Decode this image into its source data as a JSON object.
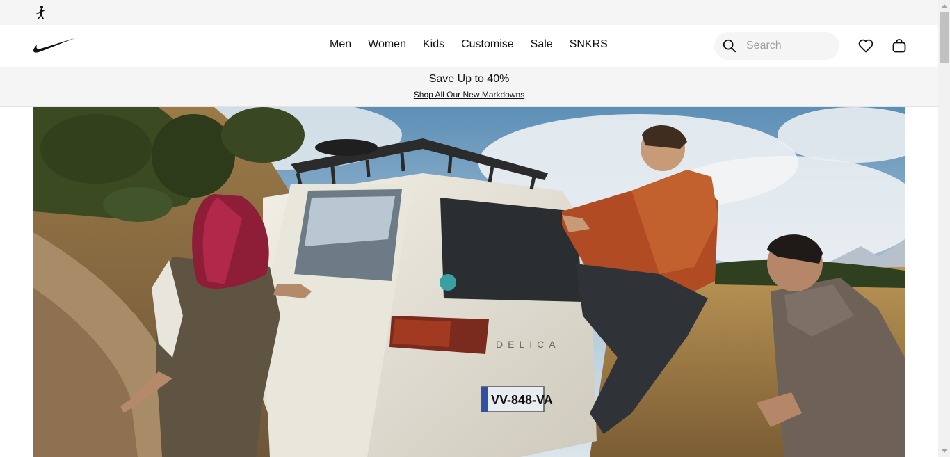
{
  "top_bar": {
    "logo_icon": "jordan-jumpman-icon"
  },
  "header": {
    "logo_icon": "nike-swoosh-icon",
    "nav": [
      {
        "label": "Men"
      },
      {
        "label": "Women"
      },
      {
        "label": "Kids"
      },
      {
        "label": "Customise"
      },
      {
        "label": "Sale"
      },
      {
        "label": "SNKRS"
      }
    ],
    "search": {
      "placeholder": "Search",
      "value": "",
      "icon": "search-icon"
    },
    "favorites_icon": "heart-icon",
    "bag_icon": "bag-icon"
  },
  "promo": {
    "title": "Save Up to 40%",
    "link": "Shop All Our New Markdowns"
  },
  "hero": {
    "image": "photo of people climbing onto a white off-road van on a hillside",
    "plate_text": "VV-848-VA",
    "badge_text": "DELICA"
  },
  "colors": {
    "topbar_bg": "#f5f5f5",
    "promo_bg": "#f5f5f5",
    "search_bg": "#f5f5f5",
    "text": "#111111"
  }
}
